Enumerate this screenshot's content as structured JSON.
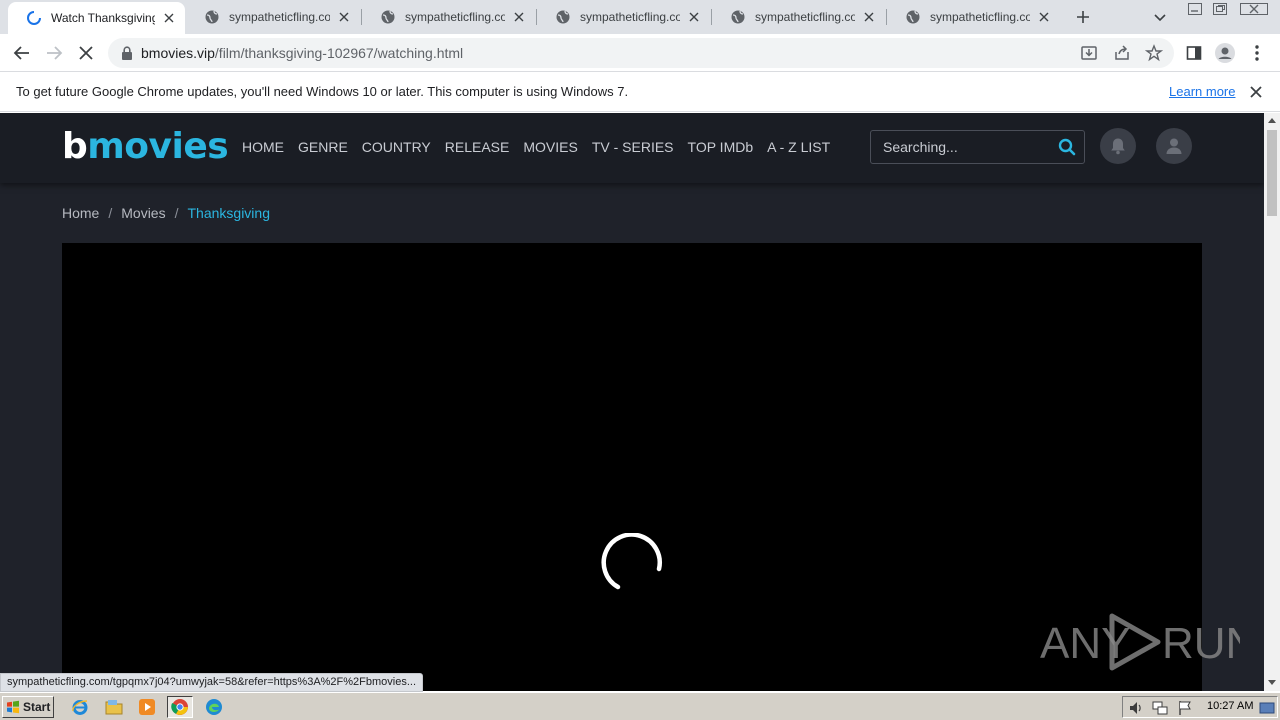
{
  "browser": {
    "tabs": [
      {
        "title": "Watch Thanksgiving Fo",
        "favicon": "loading-spinner-icon",
        "active": true
      },
      {
        "title": "sympatheticfling.com/t",
        "favicon": "globe-icon",
        "active": false
      },
      {
        "title": "sympatheticfling.com/t",
        "favicon": "globe-icon",
        "active": false
      },
      {
        "title": "sympatheticfling.com/t",
        "favicon": "globe-icon",
        "active": false
      },
      {
        "title": "sympatheticfling.com/t",
        "favicon": "globe-icon",
        "active": false
      },
      {
        "title": "sympatheticfling.com/t",
        "favicon": "globe-icon",
        "active": false
      }
    ],
    "url_host": "bmovies.vip",
    "url_path": "/film/thanksgiving-102967/watching.html",
    "infobar": {
      "message": "To get future Google Chrome updates, you'll need Windows 10 or later. This computer is using Windows 7.",
      "link": "Learn more"
    },
    "status_url": "sympatheticfling.com/tgpqmx7j04?umwyjak=58&refer=https%3A%2F%2Fbmovies..."
  },
  "site": {
    "logo_b": "b",
    "logo_rest": "movies",
    "nav": [
      "HOME",
      "GENRE",
      "COUNTRY",
      "RELEASE",
      "MOVIES",
      "TV - SERIES",
      "TOP IMDb",
      "A - Z LIST"
    ],
    "search_placeholder": "Searching...",
    "breadcrumb": {
      "home": "Home",
      "sep": "/",
      "section": "Movies",
      "current": "Thanksgiving"
    },
    "accent_color": "#2bb6e0"
  },
  "watermark": {
    "left": "ANY",
    "right": "RUN"
  },
  "taskbar": {
    "start_label": "Start",
    "clock": "10:27 AM"
  }
}
